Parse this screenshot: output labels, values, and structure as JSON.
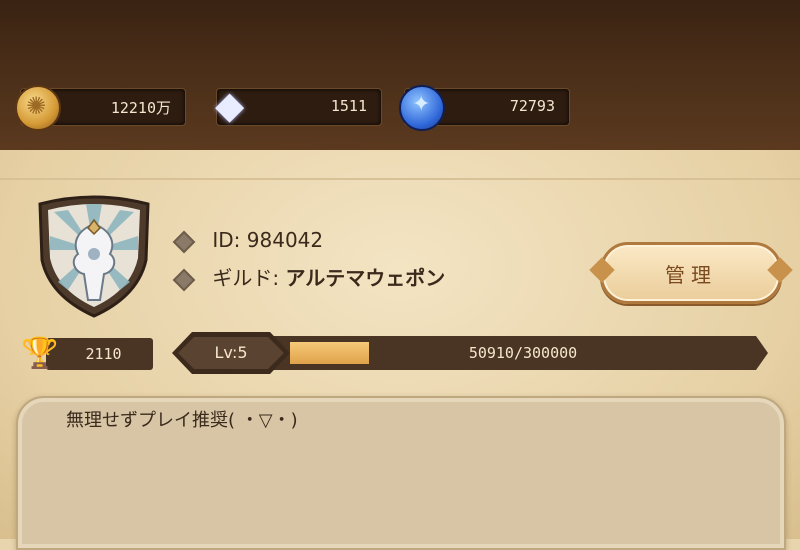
{
  "currency": {
    "gold": {
      "value": "12210万",
      "icon": "gold-coin-icon"
    },
    "gem": {
      "value": "1511",
      "icon": "diamond-icon"
    },
    "token": {
      "value": "72793",
      "icon": "blue-token-icon"
    }
  },
  "profile": {
    "id_label": "ID:",
    "id_value": "984042",
    "guild_label": "ギルド:",
    "guild_name": "アルテマウェポン",
    "manage_button": "管理"
  },
  "trophy": {
    "value": "2110",
    "icon": "trophy-icon"
  },
  "level": {
    "label": "Lv:5",
    "exp_text": "50910/300000",
    "exp_fraction": 0.1697
  },
  "message": "無理せずプレイ推奨( ・▽・)",
  "colors": {
    "header": "#3a2313",
    "parchment": "#e8d5ae",
    "exp_fill": "#e0a24a",
    "button_border": "#b07a3e"
  }
}
